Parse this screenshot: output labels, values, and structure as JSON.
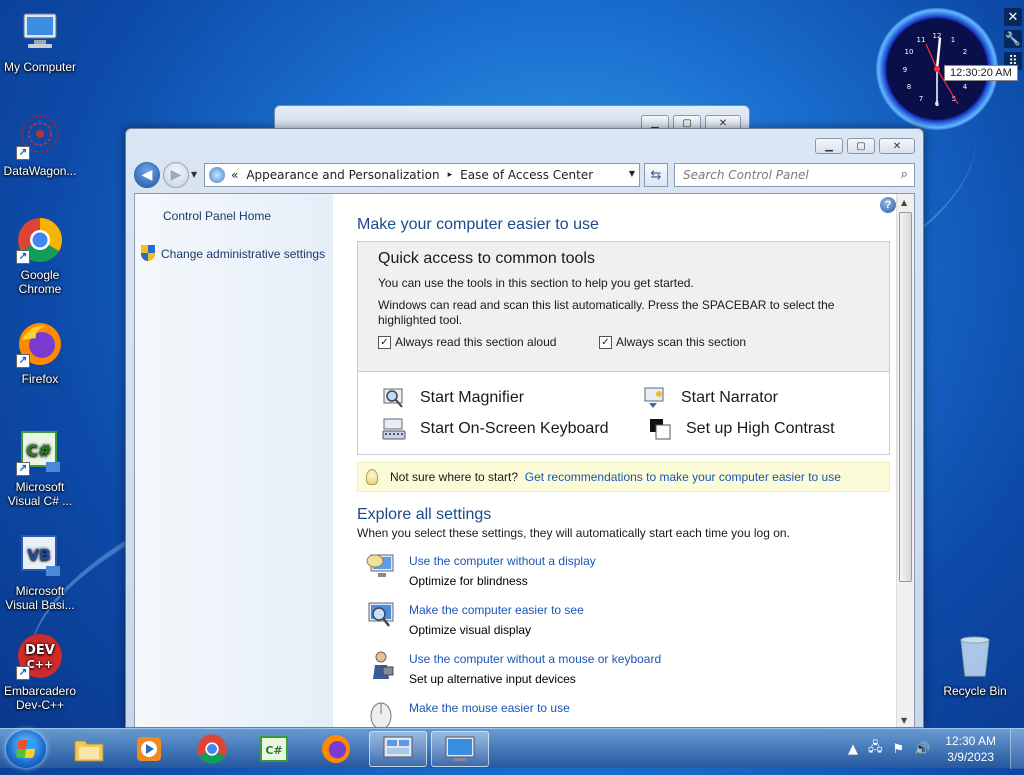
{
  "desktop": {
    "icons": [
      {
        "label": "My Computer"
      },
      {
        "label": "DataWagon..."
      },
      {
        "label": "Google Chrome"
      },
      {
        "label": "Firefox"
      },
      {
        "label": "Microsoft Visual C# ..."
      },
      {
        "label": "Microsoft Visual Basi..."
      },
      {
        "label": "Embarcadero Dev-C++"
      },
      {
        "label": "Recycle Bin"
      }
    ]
  },
  "gadget": {
    "tooltip": "12:30:20 AM",
    "controls": {
      "close": "✕",
      "options": "🔧",
      "drag": "⠿"
    }
  },
  "window": {
    "address": {
      "prefix": "«",
      "crumbs": [
        "Appearance and Personalization",
        "Ease of Access Center"
      ],
      "separator": "▸"
    },
    "search": {
      "placeholder": "Search Control Panel"
    },
    "sidebar": {
      "items": [
        {
          "label": "Control Panel Home"
        },
        {
          "label": "Change administrative settings"
        }
      ]
    },
    "main": {
      "heading": "Make your computer easier to use",
      "quick_access": {
        "title": "Quick access to common tools",
        "line1": "You can use the tools in this section to help you get started.",
        "line2": "Windows can read and scan this list automatically.  Press the SPACEBAR to select the",
        "line3": "highlighted tool.",
        "check1": {
          "label": "Always read this section aloud",
          "checked": true
        },
        "check2": {
          "label": "Always scan this section",
          "checked": true
        },
        "tools": [
          {
            "label": "Start Magnifier"
          },
          {
            "label": "Start Narrator"
          },
          {
            "label": "Start On-Screen Keyboard"
          },
          {
            "label": "Set up High Contrast"
          }
        ]
      },
      "tip": {
        "text": "Not sure where to start?",
        "link": "Get recommendations to make your computer easier to use"
      },
      "explore": {
        "heading": "Explore all settings",
        "subtitle": "When you select these settings, they will automatically start each time you log on.",
        "items": [
          {
            "link": "Use the computer without a display",
            "desc": "Optimize for blindness"
          },
          {
            "link": "Make the computer easier to see",
            "desc": "Optimize visual display"
          },
          {
            "link": "Use the computer without a mouse or keyboard",
            "desc": "Set up alternative input devices"
          },
          {
            "link": "Make the mouse easier to use",
            "desc": ""
          }
        ]
      }
    }
  },
  "taskbar": {
    "clock": {
      "time": "12:30 AM",
      "date": "3/9/2023"
    }
  }
}
